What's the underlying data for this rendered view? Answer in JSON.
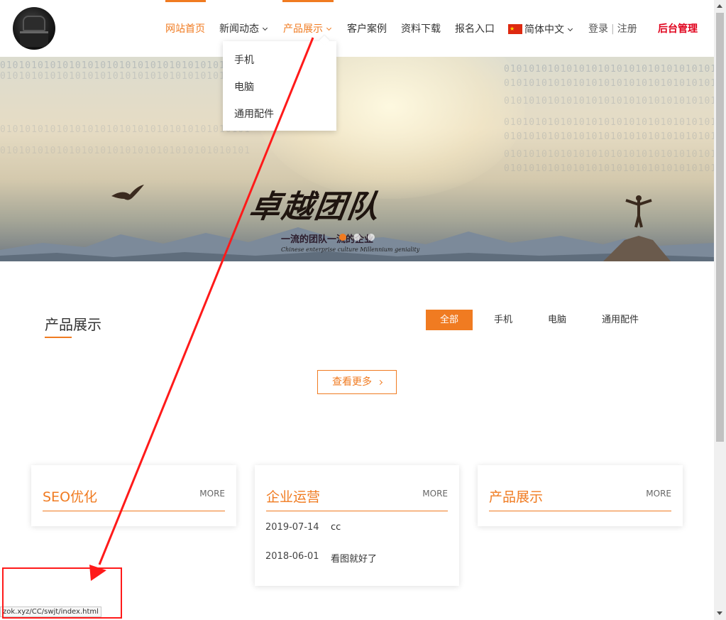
{
  "header": {
    "nav": [
      {
        "label": "网站首页",
        "active": true,
        "has_caret": false
      },
      {
        "label": "新闻动态",
        "active": false,
        "has_caret": true
      },
      {
        "label": "产品展示",
        "active": true,
        "has_caret": true
      },
      {
        "label": "客户案例",
        "active": false,
        "has_caret": false
      },
      {
        "label": "资料下载",
        "active": false,
        "has_caret": false
      },
      {
        "label": "报名入口",
        "active": false,
        "has_caret": false
      }
    ],
    "language": "简体中文",
    "login": "登录",
    "separator": "|",
    "register": "注册",
    "admin": "后台管理"
  },
  "dropdown": {
    "items": [
      "手机",
      "电脑",
      "通用配件"
    ]
  },
  "banner": {
    "title": "卓越团队",
    "subtitle": "一流的团队一流的企业",
    "subtitle_en": "Chinese enterprise culture  Millennium geniality",
    "binary": "0101010101010101010101010101010101010101",
    "slide_count": 3,
    "active_slide": 0
  },
  "products": {
    "title": "产品展示",
    "tabs": [
      "全部",
      "手机",
      "电脑",
      "通用配件"
    ],
    "active_tab": 0,
    "more_label": "查看更多"
  },
  "cards": [
    {
      "title": "SEO优化",
      "more": "MORE",
      "items": []
    },
    {
      "title": "企业运营",
      "more": "MORE",
      "items": [
        {
          "date": "2019-07-14",
          "title": "cc"
        },
        {
          "date": "2018-06-01",
          "title": "看图就好了"
        }
      ]
    },
    {
      "title": "产品展示",
      "more": "MORE",
      "items": []
    }
  ],
  "status_url": "zok.xyz/CC/swjt/index.html",
  "colors": {
    "accent": "#f07b21",
    "admin": "#e0001b",
    "annotation": "#ff1a1a"
  },
  "icons": [
    "logo-avatar",
    "china-flag-icon",
    "chevron-down-icon",
    "chevron-right-icon"
  ]
}
